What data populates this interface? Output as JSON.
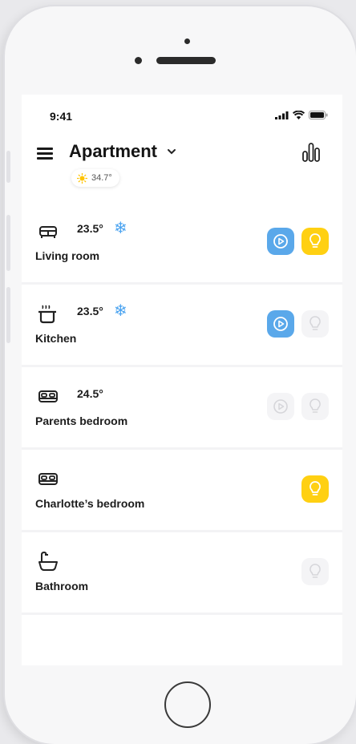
{
  "status_bar": {
    "time": "9:41"
  },
  "header": {
    "title": "Apartment"
  },
  "weather": {
    "temp": "34.7°"
  },
  "colors": {
    "accent_blue": "#5aa8ea",
    "accent_yellow": "#ffd012",
    "inactive": "#f4f4f6"
  },
  "rooms": [
    {
      "name": "Living room",
      "temp": "23.5°",
      "cooling": true,
      "icon": "sofa-icon",
      "play": "on",
      "light": "on"
    },
    {
      "name": "Kitchen",
      "temp": "23.5°",
      "cooling": true,
      "icon": "pot-icon",
      "play": "on",
      "light": "off"
    },
    {
      "name": "Parents bedroom",
      "temp": "24.5°",
      "cooling": false,
      "icon": "bed-icon",
      "play": "off",
      "light": "off"
    },
    {
      "name": "Charlotte’s bedroom",
      "temp": "",
      "cooling": false,
      "icon": "bed-icon",
      "play": "none",
      "light": "on"
    },
    {
      "name": "Bathroom",
      "temp": "",
      "cooling": false,
      "icon": "bathtub-icon",
      "play": "none",
      "light": "off"
    }
  ]
}
